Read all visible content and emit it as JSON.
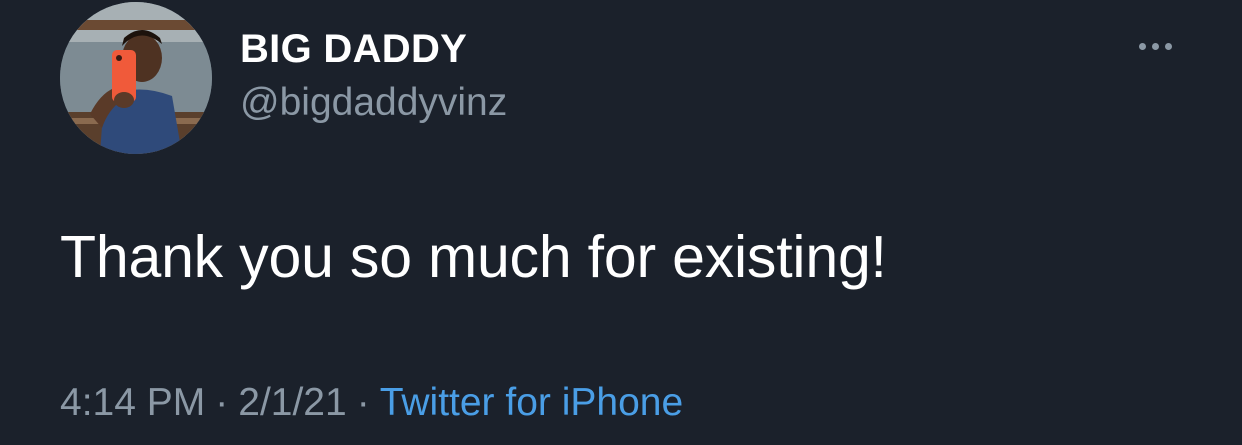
{
  "tweet": {
    "author": {
      "display_name": "BIG DADDY",
      "handle": "@bigdaddyvinz"
    },
    "menu_icon": "more-horizontal-icon",
    "text": "Thank you so much for existing!",
    "meta": {
      "time": "4:14 PM",
      "separator": "·",
      "date": "2/1/21",
      "source": "Twitter for iPhone"
    }
  },
  "colors": {
    "background": "#1b212b",
    "primary_text": "#ffffff",
    "secondary_text": "#8b98a5",
    "link": "#4a9ee6"
  }
}
